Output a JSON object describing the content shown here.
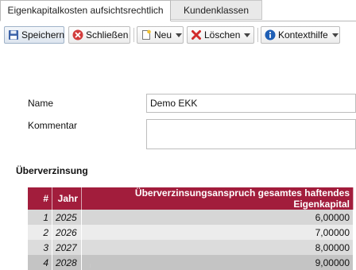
{
  "tabs": [
    {
      "label": "Eigenkapitalkosten aufsichtsrechtlich"
    },
    {
      "label": "Kundenklassen"
    }
  ],
  "toolbar": {
    "save_label": "Speichern",
    "close_label": "Schließen",
    "new_label": "Neu",
    "delete_label": "Löschen",
    "help_label": "Kontexthilfe"
  },
  "form": {
    "name_label": "Name",
    "name_value": "Demo EKK",
    "comment_label": "Kommentar",
    "comment_value": ""
  },
  "section": {
    "title": "Überverzinsung"
  },
  "table": {
    "headers": [
      "#",
      "Jahr",
      "Überverzinsungsanspruch gesamtes haftendes Eigenkapital"
    ],
    "rows": [
      {
        "num": "1",
        "jahr": "2025",
        "value": "6,00000"
      },
      {
        "num": "2",
        "jahr": "2026",
        "value": "7,00000"
      },
      {
        "num": "3",
        "jahr": "2027",
        "value": "8,00000"
      },
      {
        "num": "4",
        "jahr": "2028",
        "value": "9,00000"
      }
    ]
  },
  "colors": {
    "header_bg": "#a21d3c",
    "close_icon": "#d23b3b",
    "delete_icon": "#d12b2b",
    "help_icon": "#1f5fb5"
  }
}
